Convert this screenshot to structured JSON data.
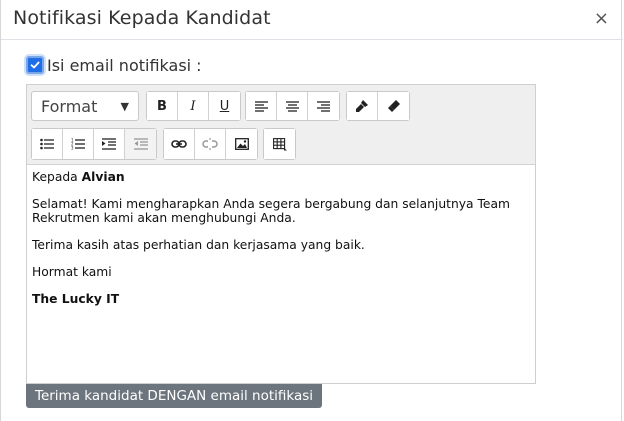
{
  "dialog": {
    "title": "Notifikasi Kepada Kandidat",
    "close": "×"
  },
  "checkbox": {
    "label": "Isi email notifikasi :",
    "checked": true
  },
  "toolbar": {
    "format_label": "Format",
    "bold": "B",
    "italic": "I",
    "underline": "U",
    "icons": [
      "align-left-icon",
      "align-center-icon",
      "align-right-icon",
      "brush-icon",
      "eraser-icon",
      "bullet-list-icon",
      "numbered-list-icon",
      "indent-icon",
      "outdent-icon",
      "link-icon",
      "unlink-icon",
      "image-icon",
      "table-icon"
    ]
  },
  "email": {
    "greeting_prefix": "Kepada",
    "name": "Alvian",
    "para1": "Selamat! Kami mengharapkan Anda segera bergabung dan selanjutnya Team Rekrutmen kami akan menghubungi Anda.",
    "para2": "Terima kasih atas perhatian dan kerjasama yang baik.",
    "closing": "Hormat kami",
    "signature": "The Lucky IT"
  },
  "actions": {
    "accept_label": "Terima kandidat DENGAN email notifikasi"
  },
  "colors": {
    "accent": "#1f6ee8",
    "button_gray": "#6c757d"
  }
}
